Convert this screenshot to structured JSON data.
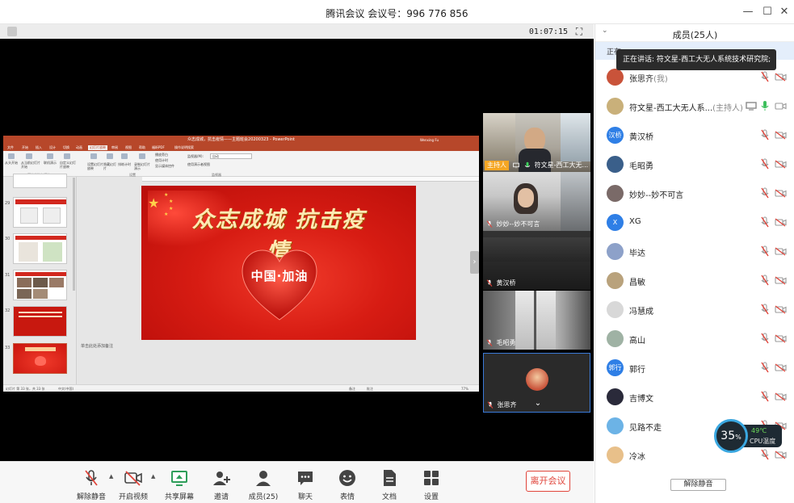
{
  "window": {
    "title": "腾讯会议 会议号：996 776 856"
  },
  "meeting": {
    "timer": "01:07:15"
  },
  "ppt": {
    "window_title": "众志成城，抗击疫情——主题班会20200323 - PowerPoint",
    "account": "Wenxing Fu",
    "tabs": [
      "文件",
      "开始",
      "插入",
      "设计",
      "切换",
      "动画",
      "幻灯片放映",
      "审阅",
      "视图",
      "帮助",
      "福昕PDF",
      "操作说明搜索"
    ],
    "active_tab": "幻灯片放映",
    "ribbon": {
      "from_start": "从头开始",
      "from_current": "从当前幻灯片开始",
      "online": "联机演示",
      "custom": "自定义幻灯片放映",
      "group_start": "开始放映幻灯片",
      "setup": "设置幻灯片放映",
      "hide": "隐藏幻灯片",
      "rehearse": "排练计时",
      "record": "录制幻灯片演示",
      "group_setup": "设置",
      "opt_narration": "播放旁白",
      "opt_timing": "使用计时",
      "opt_media": "显示媒体控件",
      "monitor_label": "监视器(M):",
      "monitor_value": "自动",
      "presenter_view": "使用演示者视图",
      "group_monitor": "监视器"
    },
    "thumb_numbers": [
      "29",
      "30",
      "31",
      "32",
      "33"
    ],
    "slide": {
      "slogan": "众志成城 抗击疫情",
      "heart_text": "中国·加油"
    },
    "notes_placeholder": "单击此处添加备注",
    "status": {
      "slide_count": "幻灯片 第 33 张，共 33 张",
      "language": "中文(中国)",
      "notes": "备注",
      "comments": "批注",
      "zoom": "77%"
    }
  },
  "participants_video": [
    {
      "label": "符文星-西工大无...",
      "host_tag": "主持人",
      "host": true
    },
    {
      "label": "妙妙--妙不可言",
      "host": false
    },
    {
      "label": "黄汉桥",
      "host": false
    },
    {
      "label": "毛昭勇",
      "host": false
    },
    {
      "label": "张思齐",
      "host": false
    }
  ],
  "toolbar": {
    "unmute": "解除静音",
    "start_video": "开启视频",
    "share_screen": "共享屏幕",
    "invite": "邀请",
    "members": "成员(25)",
    "chat": "聊天",
    "reaction": "表情",
    "docs": "文档",
    "settings": "设置",
    "leave": "离开会议"
  },
  "panel": {
    "title": "成员(25人)",
    "speaking_prefix": "正在",
    "tooltip": "正在讲话: 符文星-西工大无人系统技术研究院;",
    "unmute_all": "解除静音",
    "members": [
      {
        "name": "张思齐",
        "suffix": "(我)",
        "avatar": "",
        "color": "#c9533a"
      },
      {
        "name": "符文星-西工大无人系...",
        "suffix": "(主持人)",
        "avatar": "",
        "color": "#c9b07a",
        "sharing": true,
        "mic_on": true
      },
      {
        "name": "黄汉桥",
        "suffix": "",
        "avatar": "汉桥",
        "color": "#2f7fe6"
      },
      {
        "name": "毛昭勇",
        "suffix": "",
        "avatar": "",
        "color": "#3a5f8a"
      },
      {
        "name": "妙妙--妙不可言",
        "suffix": "",
        "avatar": "",
        "color": "#7a6a68"
      },
      {
        "name": "XG",
        "suffix": "",
        "avatar": "X",
        "color": "#2f7fe6"
      },
      {
        "name": "毕达",
        "suffix": "",
        "avatar": "",
        "color": "#8da1c9"
      },
      {
        "name": "昌敏",
        "suffix": "",
        "avatar": "",
        "color": "#b9a27c"
      },
      {
        "name": "冯慧成",
        "suffix": "",
        "avatar": "",
        "color": "#d8d8d8"
      },
      {
        "name": "高山",
        "suffix": "",
        "avatar": "",
        "color": "#9fb2a4"
      },
      {
        "name": "郭行",
        "suffix": "",
        "avatar": "郭行",
        "color": "#2f7fe6"
      },
      {
        "name": "吉博文",
        "suffix": "",
        "avatar": "",
        "color": "#2a2a3a"
      },
      {
        "name": "见路不走",
        "suffix": "",
        "avatar": "",
        "color": "#6cb3e6"
      },
      {
        "name": "冷冰",
        "suffix": "",
        "avatar": "",
        "color": "#e8c08a"
      }
    ]
  },
  "cpu": {
    "percent": "35",
    "percent_sign": "%",
    "temperature": "49℃",
    "label": "CPU温度"
  }
}
